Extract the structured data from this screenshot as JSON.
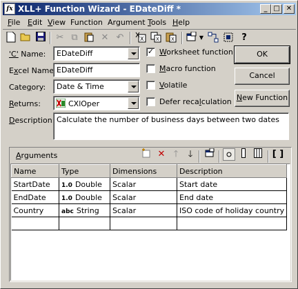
{
  "window": {
    "title": "XLL+ Function Wizard - EDateDiff *",
    "icon_text": "fx"
  },
  "menu": [
    {
      "label": "File",
      "ul": "F",
      "rest": "ile"
    },
    {
      "label": "Edit",
      "ul": "E",
      "rest": "dit"
    },
    {
      "label": "View",
      "ul": "V",
      "rest": "iew"
    },
    {
      "label": "Function",
      "ul": "",
      "rest": "Function"
    },
    {
      "label": "Argument",
      "ul": "",
      "rest": "Argument"
    },
    {
      "label": "Tools",
      "ul": "T",
      "rest": "ools"
    },
    {
      "label": "Help",
      "ul": "H",
      "rest": "elp"
    }
  ],
  "form": {
    "c_name_label_ul": "'C'",
    "c_name_label_rest": " Name:",
    "c_name_value": "EDateDiff",
    "excel_name_label_pre": "E",
    "excel_name_label_ul": "x",
    "excel_name_label_rest": "cel Name:",
    "excel_name_value": "EDateDiff",
    "category_label_pre": "Cate",
    "category_label_ul": "g",
    "category_label_rest": "ory:",
    "category_value": "Date & Time",
    "returns_label_ul": "R",
    "returns_label_rest": "eturns:",
    "returns_value": "CXlOper",
    "description_label_ul": "D",
    "description_label_rest": "escription:",
    "description_value": "Calculate the number of business days between two dates"
  },
  "options": {
    "worksheet_function": {
      "label_ul": "W",
      "label_rest": "orksheet function",
      "checked": true,
      "mark": "✓"
    },
    "macro_function": {
      "label_ul": "M",
      "label_rest": "acro function",
      "checked": false
    },
    "volatile": {
      "label_ul": "V",
      "label_rest": "olatile",
      "checked": false
    },
    "defer_recalculation": {
      "label_pre": "Defer reca",
      "label_ul": "l",
      "label_rest": "culation",
      "checked": false
    }
  },
  "buttons": {
    "ok": "OK",
    "cancel": "Cancel",
    "new_function_ul": "N",
    "new_function_rest": "ew Function"
  },
  "arguments": {
    "title_ul": "A",
    "title_rest": "rguments",
    "columns": [
      "Name",
      "Type",
      "Dimensions",
      "Description"
    ],
    "rows": [
      {
        "name": "StartDate",
        "type_icon": "1.0",
        "type": "Double",
        "dimensions": "Scalar",
        "description": "Start date"
      },
      {
        "name": "EndDate",
        "type_icon": "1.0",
        "type": "Double",
        "dimensions": "Scalar",
        "description": "End date"
      },
      {
        "name": "Country",
        "type_icon": "abc",
        "type": "String",
        "dimensions": "Scalar",
        "description": "ISO code of holiday country"
      }
    ]
  }
}
